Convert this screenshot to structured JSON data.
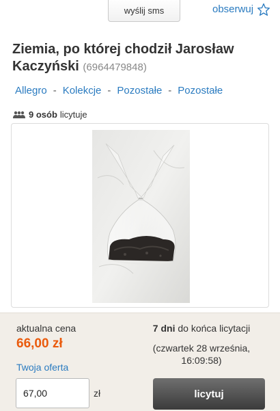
{
  "header": {
    "sms_button": "wyślij sms",
    "watch_label": "obserwuj",
    "watch_icon": "star-icon"
  },
  "item": {
    "title": "Ziemia, po której chodził Jarosław Kaczyński",
    "id": "(6964479848)"
  },
  "breadcrumbs": [
    "Allegro",
    "Kolekcje",
    "Pozostałe",
    "Pozostałe"
  ],
  "bidders": {
    "icon": "people-icon",
    "count": "9 osób",
    "suffix": "licytuje"
  },
  "photo": {
    "description_icon": "product-photo"
  },
  "auction": {
    "price_label": "aktualna cena",
    "price": "66,00 zł",
    "offer_label": "Twoja oferta",
    "offer_value": "67,00",
    "currency": "zł",
    "days": "7 dni",
    "days_suffix": "do końca licytacji",
    "end_date": "(czwartek 28 września,",
    "end_time": "16:09:58)",
    "bid_button": "licytuj"
  },
  "colors": {
    "link": "#2a7bc0",
    "price": "#ea5a0c",
    "panel": "#f2eee8",
    "button": "#4a4a4a"
  }
}
